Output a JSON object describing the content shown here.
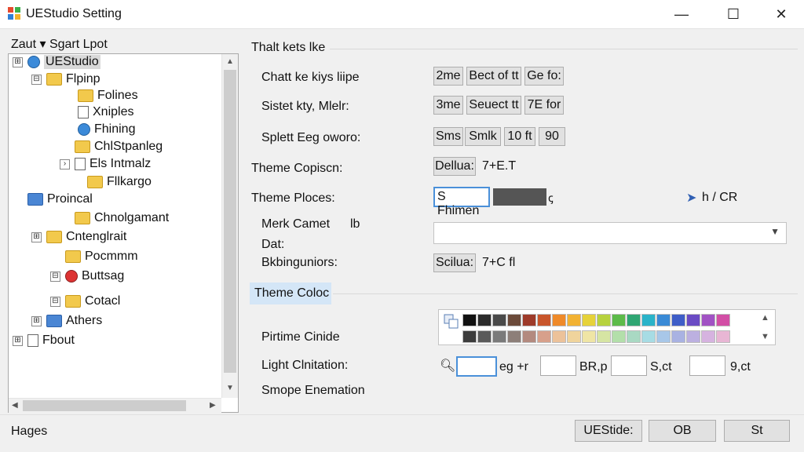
{
  "window": {
    "title": "UEStudio Setting",
    "minimize_glyph": "—",
    "maximize_glyph": "☐",
    "close_glyph": "✕"
  },
  "menu": {
    "text": "Zaut ▾ Sgart  Lpot"
  },
  "tree": {
    "items": [
      {
        "label": "UEStudio",
        "icon": "globe-icon",
        "expander": "⊞"
      },
      {
        "label": "Flpinp",
        "icon": "folder-icon",
        "expander": "⊟"
      },
      {
        "label": "Folines",
        "icon": "folder-icon",
        "expander": ""
      },
      {
        "label": "Xniples",
        "icon": "document-icon",
        "expander": ""
      },
      {
        "label": "Fhining",
        "icon": "globe-icon",
        "expander": ""
      },
      {
        "label": "ChlStpanleg",
        "icon": "folder-icon",
        "expander": ""
      },
      {
        "label": "Els Intmalz",
        "icon": "document-icon",
        "expander": "›"
      },
      {
        "label": "Fllkargo",
        "icon": "folder-icon",
        "expander": ""
      },
      {
        "label": "Proincal",
        "icon": "folder-blue-icon",
        "expander": ""
      },
      {
        "label": "Chnolgamant",
        "icon": "folder-icon",
        "expander": ""
      },
      {
        "label": "Cntenglrait",
        "icon": "folder-icon",
        "expander": "⊞"
      },
      {
        "label": "Pocmmm",
        "icon": "folder-icon",
        "expander": ""
      },
      {
        "label": "Buttsag",
        "icon": "record-icon",
        "expander": "⊟"
      },
      {
        "label": "Cotacl",
        "icon": "folder-icon",
        "expander": "⊟"
      },
      {
        "label": "Athers",
        "icon": "folder-blue-icon",
        "expander": "⊞"
      },
      {
        "label": "Fbout",
        "icon": "document-icon",
        "expander": "⊞"
      }
    ]
  },
  "settings": {
    "section_title": "Thalt kets lke",
    "rows": [
      {
        "label": "Chatt ke kiys liipe",
        "buttons": [
          "2me",
          "Bect of tt",
          "Ge fo:"
        ]
      },
      {
        "label": "Sistet kty, Mlelr:",
        "buttons": [
          "3me",
          "Seuect tt",
          "7E for"
        ]
      },
      {
        "label": "Splett Eeg oworo:",
        "buttons": [
          "Sms",
          "Smlk",
          "10 ft",
          "90"
        ]
      }
    ],
    "theme_copison": {
      "label": "Theme Copiscn:",
      "button": "Dellua:",
      "shortcut": "7+E.T"
    },
    "theme_ploces": {
      "label": "Theme Ploces:",
      "input_value": "S Fhimen",
      "trailing": "h / CR"
    },
    "merk_camet": {
      "label": "Merk Camet",
      "label_suffix": "lb",
      "sub_label": "Dat:",
      "combo_value": ""
    },
    "bkbing": {
      "label": "Bkbinguniors:",
      "button": "Scilua:",
      "shortcut": "7+C fl"
    },
    "theme_color": {
      "tab_label": "Theme Coloc",
      "pirtime_label": "Pirtime Cinide",
      "light_label": "Light Clnitation:",
      "smope_label": "Smope Enemation",
      "fields": [
        "eg +r",
        "BR,p",
        "S,ct",
        "9,ct"
      ],
      "palette_row1": [
        "#111111",
        "#2b2b2b",
        "#4a4a4a",
        "#6b4a3a",
        "#9e3b2a",
        "#c8552b",
        "#ef8a2a",
        "#f2b233",
        "#e6d23a",
        "#b7d23e",
        "#5dbb4a",
        "#2fa673",
        "#2ab3c9",
        "#3a8ad6",
        "#3f5ec8",
        "#6a4bc4",
        "#a152c4",
        "#d24ea5"
      ],
      "palette_row2": [
        "#3c3c3c",
        "#5a5a5a",
        "#7a7a7a",
        "#8d7f79",
        "#b38a7f",
        "#d7a08b",
        "#ecc29a",
        "#f0d49c",
        "#efe5a5",
        "#d6e5a3",
        "#b3dfaa",
        "#a9d9c3",
        "#a7dce4",
        "#a8c7e8",
        "#a9b2e2",
        "#bcb0e0",
        "#d6b3e0",
        "#e8b6d4"
      ]
    }
  },
  "footer": {
    "status": "Hages",
    "buttons": [
      "UEStide:",
      "OB",
      "St"
    ]
  }
}
